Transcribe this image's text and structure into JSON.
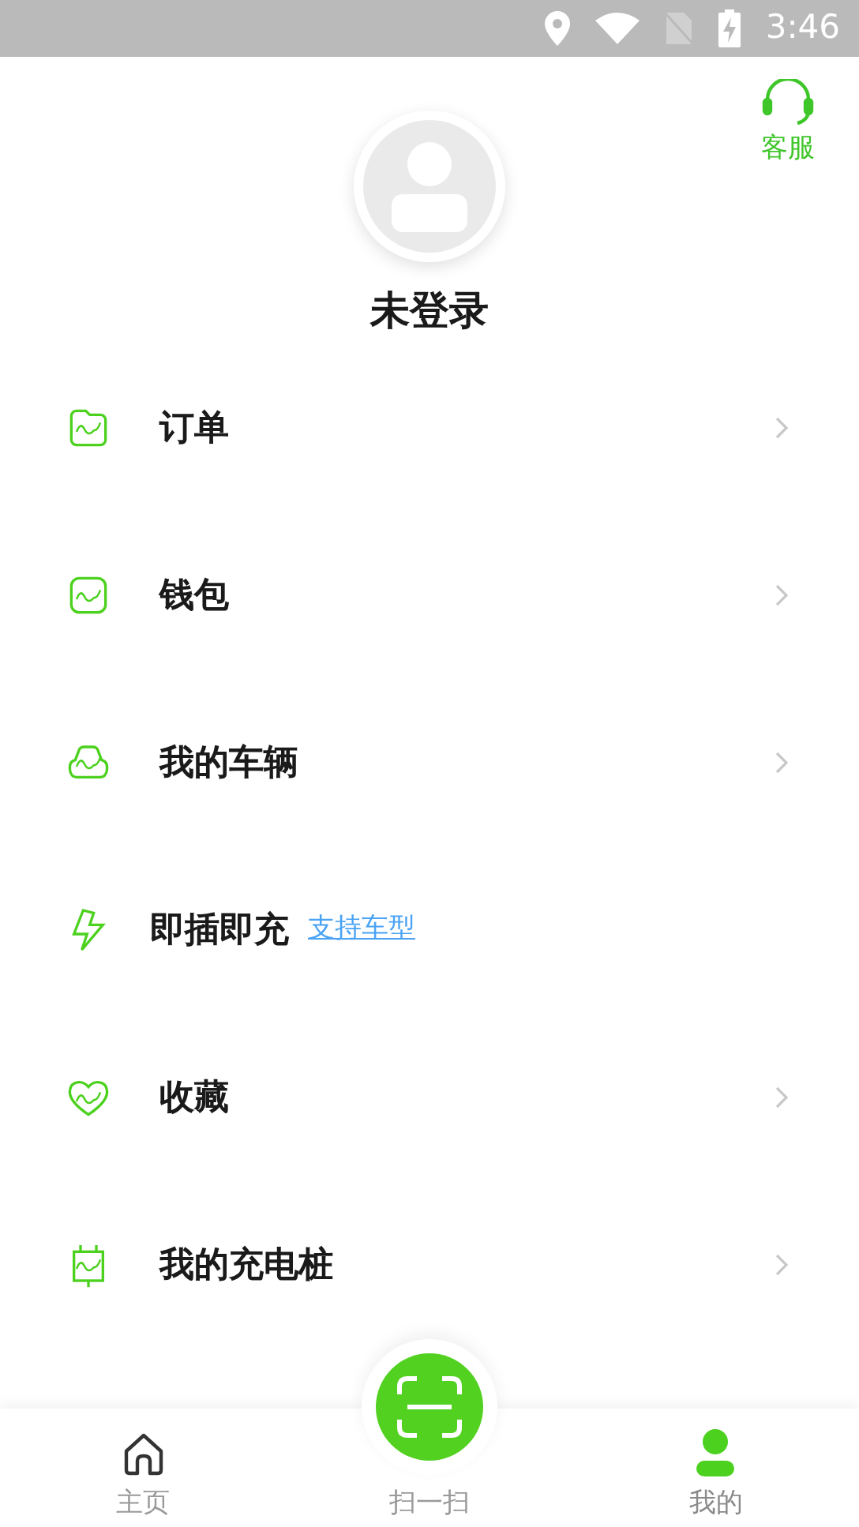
{
  "status_bar": {
    "time": "3:46"
  },
  "header": {
    "service_label": "客服",
    "user_name": "未登录"
  },
  "menu": [
    {
      "kind": "nav",
      "label": "订单"
    },
    {
      "kind": "nav",
      "label": "钱包"
    },
    {
      "kind": "nav",
      "label": "我的车辆"
    },
    {
      "kind": "promo",
      "label": "即插即充",
      "link": "支持车型"
    },
    {
      "kind": "nav",
      "label": "收藏"
    },
    {
      "kind": "nav",
      "label": "我的充电桩"
    }
  ],
  "tab_bar": [
    {
      "kind": "home",
      "label": "主页",
      "selected": false
    },
    {
      "kind": "scan",
      "label": "扫一扫",
      "selected": false
    },
    {
      "kind": "me",
      "label": "我的",
      "selected": true
    }
  ]
}
